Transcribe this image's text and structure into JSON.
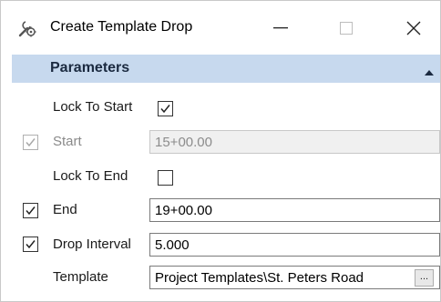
{
  "window": {
    "title": "Create Template Drop",
    "icon": "wrench-gear-icon",
    "controls": {
      "minimize": "minimize-icon",
      "maximize": "maximize-icon",
      "close": "close-icon"
    }
  },
  "section": {
    "title": "Parameters",
    "collapse_icon": "chevron-up-icon",
    "header_color": "#c7d9ee"
  },
  "fields": {
    "lock_to_start": {
      "label": "Lock To Start",
      "checked": true
    },
    "start": {
      "label": "Start",
      "value": "15+00.00",
      "checked": true,
      "enabled": false
    },
    "lock_to_end": {
      "label": "Lock To End",
      "checked": false
    },
    "end": {
      "label": "End",
      "value": "19+00.00",
      "checked": true
    },
    "drop_interval": {
      "label": "Drop Interval",
      "value": "5.000",
      "checked": true
    },
    "template": {
      "label": "Template",
      "value": "Project Templates\\St. Peters Road",
      "browse_label": "..."
    }
  }
}
